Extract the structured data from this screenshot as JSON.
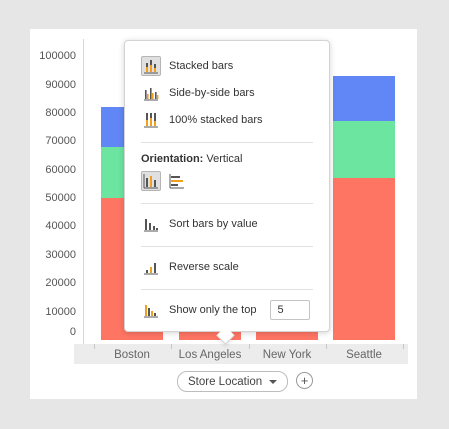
{
  "chart_data": {
    "type": "bar",
    "stacked": true,
    "categories": [
      "Boston",
      "Los Angeles",
      "New York",
      "Seattle"
    ],
    "series": [
      {
        "color": "#ff7563",
        "values": [
          50000,
          50000,
          50000,
          57000
        ]
      },
      {
        "color": "#6be5a0",
        "values": [
          18000,
          18000,
          18000,
          20000
        ]
      },
      {
        "color": "#6087f5",
        "values": [
          14000,
          14000,
          14000,
          16000
        ]
      }
    ],
    "yticks": [
      "100000",
      "90000",
      "80000",
      "70000",
      "60000",
      "50000",
      "40000",
      "30000",
      "20000",
      "10000",
      "0"
    ],
    "ylim": [
      0,
      105000
    ],
    "xlabel": "Store Location",
    "legend": "none"
  },
  "axis_selector": {
    "label": "Store Location"
  },
  "popover": {
    "items": [
      {
        "label": "Stacked bars",
        "icon": "stacked-bars-icon",
        "selected": true
      },
      {
        "label": "Side-by-side bars",
        "icon": "side-by-side-bars-icon",
        "selected": false
      },
      {
        "label": "100% stacked bars",
        "icon": "percent-stacked-bars-icon",
        "selected": false
      }
    ],
    "orientation": {
      "label": "Orientation:",
      "value": "Vertical",
      "options": [
        "vertical",
        "horizontal"
      ],
      "selected": "vertical"
    },
    "sort_label": "Sort bars by value",
    "reverse_label": "Reverse scale",
    "show_top_label": "Show only the top",
    "show_top_value": "5"
  },
  "colors": {
    "orange": "#f0a020",
    "icon_gray": "#555555"
  }
}
